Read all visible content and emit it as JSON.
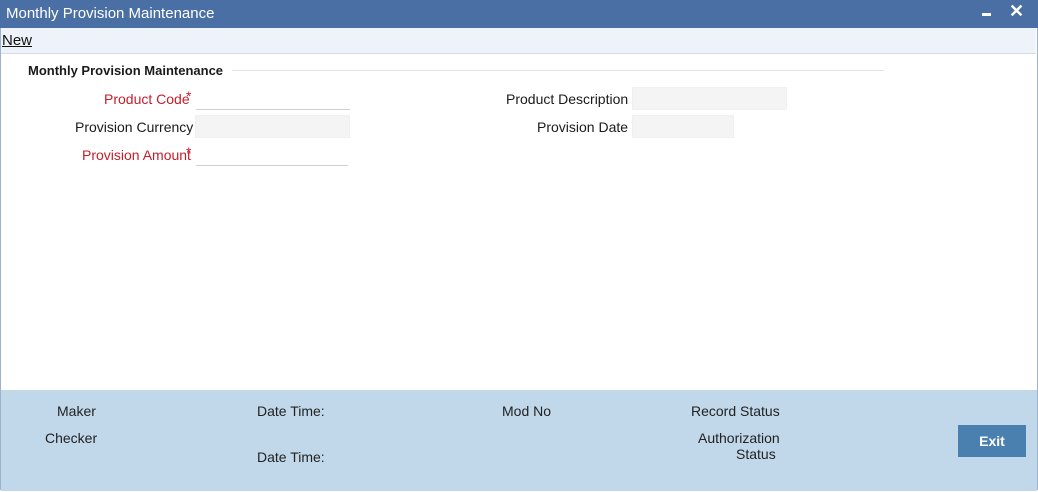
{
  "window": {
    "title": "Monthly Provision Maintenance",
    "minimize_glyph": "",
    "close_glyph": "✕"
  },
  "menu": {
    "new_label": "New"
  },
  "section": {
    "title": "Monthly Provision Maintenance"
  },
  "form": {
    "product_code": {
      "label": "Product Code",
      "required_mark": "*",
      "value": ""
    },
    "provision_currency": {
      "label": "Provision Currency",
      "value": ""
    },
    "provision_amount": {
      "label": "Provision Amount",
      "required_mark": "*",
      "value": ""
    },
    "product_description": {
      "label": "Product Description",
      "value": ""
    },
    "provision_date": {
      "label": "Provision Date",
      "value": ""
    }
  },
  "footer": {
    "maker_label": "Maker",
    "checker_label": "Checker",
    "date_time_label_1": "Date Time:",
    "date_time_label_2": "Date Time:",
    "mod_no_label": "Mod No",
    "record_status_label": "Record Status",
    "authorization_status_line1": "Authorization",
    "authorization_status_line2": "Status",
    "exit_label": "Exit"
  },
  "colors": {
    "titlebar": "#4a6fa5",
    "required": "#c41e2b",
    "footer": "#c1d8ea",
    "exit_button": "#4a80b0"
  }
}
